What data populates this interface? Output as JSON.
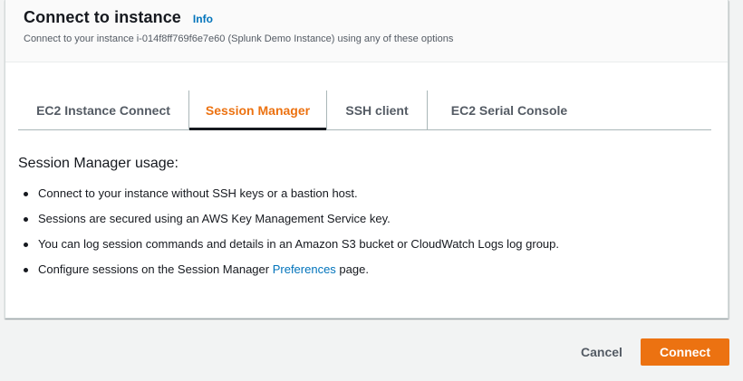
{
  "header": {
    "title": "Connect to instance",
    "info_label": "Info",
    "subtitle": "Connect to your instance i-014f8ff769f6e7e60 (Splunk Demo Instance) using any of these options"
  },
  "tabs": [
    {
      "label": "EC2 Instance Connect",
      "active": false
    },
    {
      "label": "Session Manager",
      "active": true
    },
    {
      "label": "SSH client",
      "active": false
    },
    {
      "label": "EC2 Serial Console",
      "active": false
    }
  ],
  "content": {
    "heading": "Session Manager usage:",
    "bullets": [
      "Connect to your instance without SSH keys or a bastion host.",
      "Sessions are secured using an AWS Key Management Service key.",
      "You can log session commands and details in an Amazon S3 bucket or CloudWatch Logs log group."
    ],
    "last_bullet_prefix": "Configure sessions on the Session Manager ",
    "last_bullet_link": "Preferences",
    "last_bullet_suffix": " page."
  },
  "footer": {
    "cancel_label": "Cancel",
    "connect_label": "Connect"
  },
  "colors": {
    "accent_orange": "#ec7211",
    "link_blue": "#0073bb",
    "text_dark": "#16191f",
    "text_muted": "#545b64"
  }
}
